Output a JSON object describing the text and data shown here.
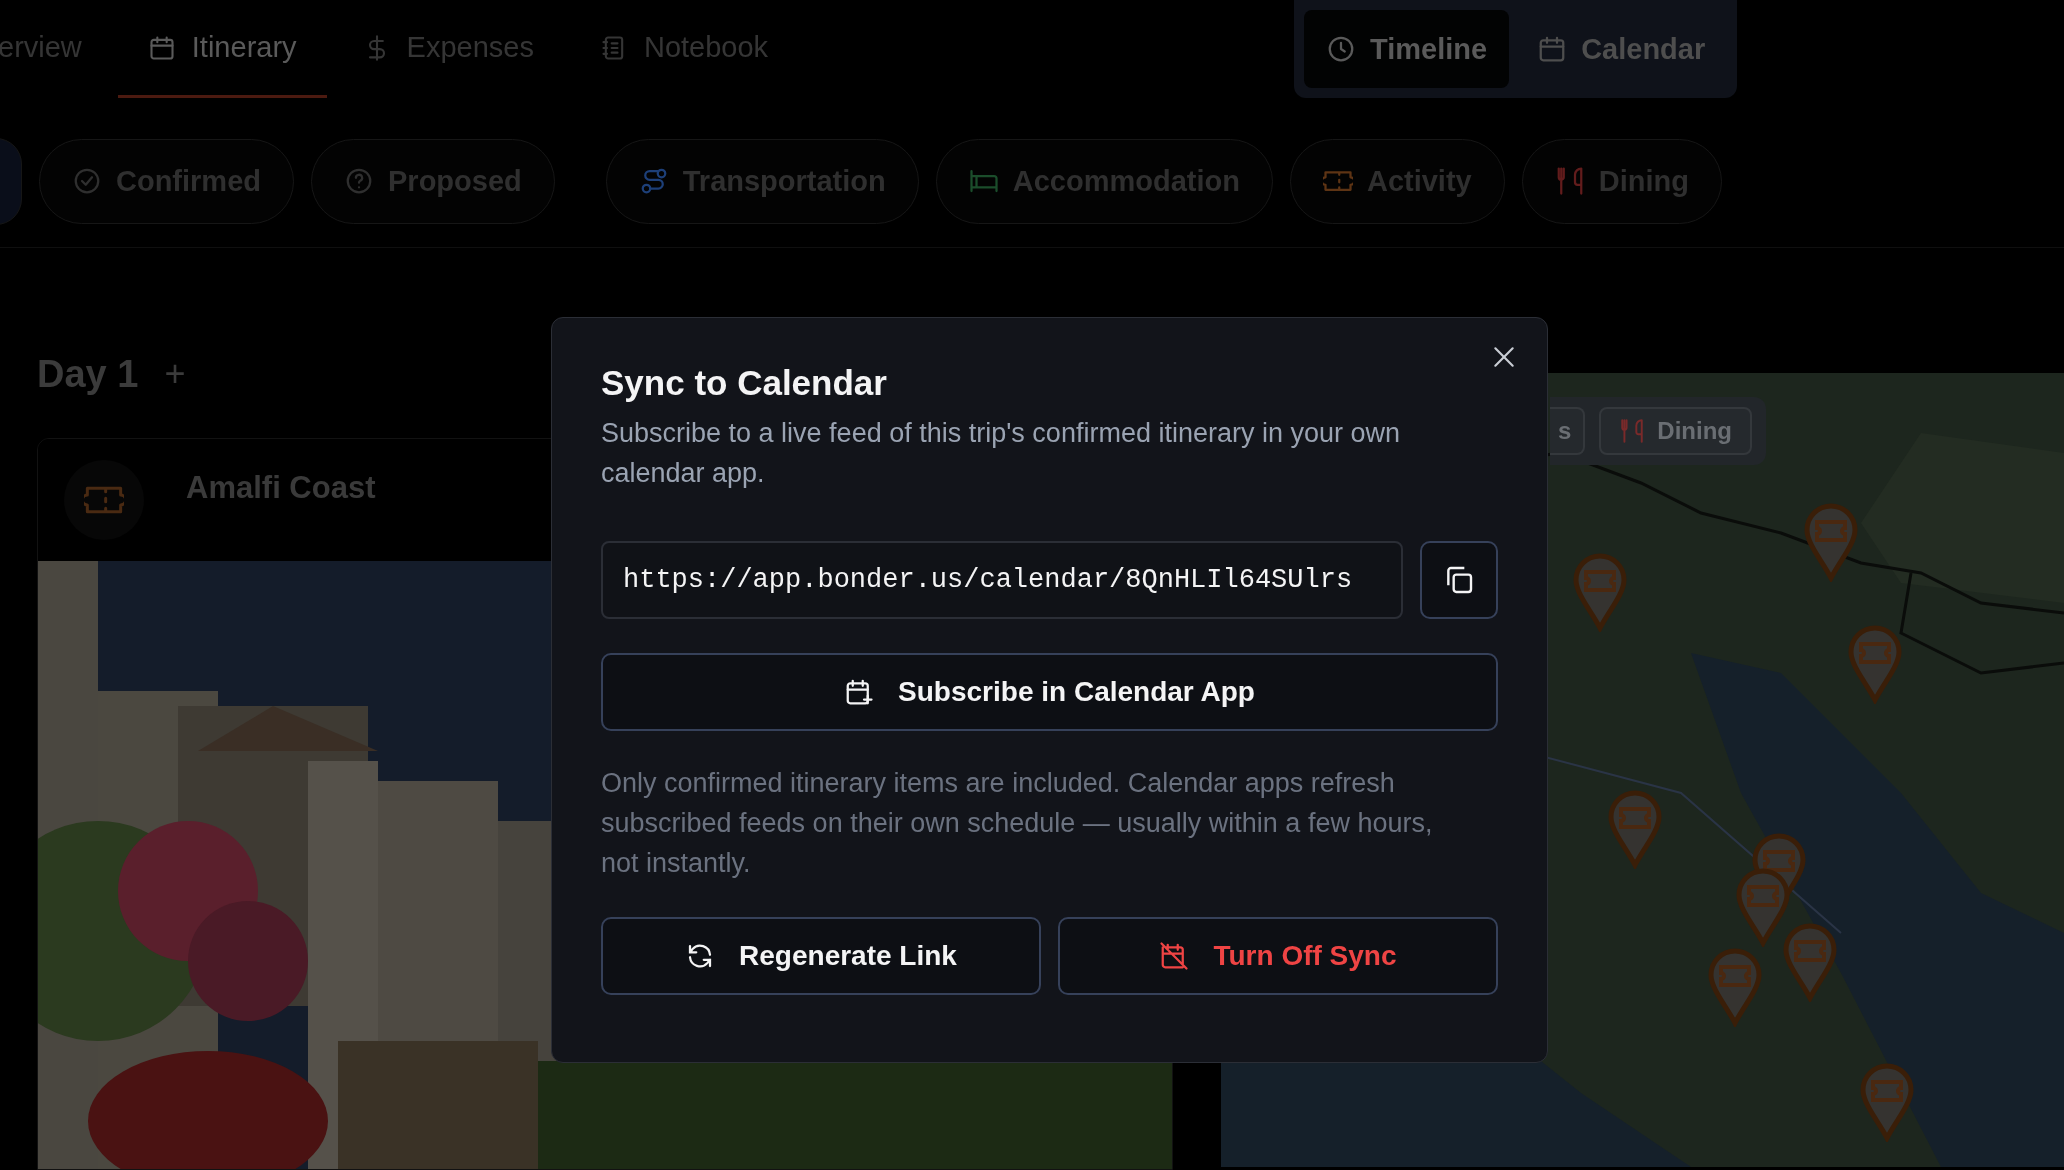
{
  "nav_tabs": [
    {
      "label": "erview",
      "kind": "overview",
      "selected": false
    },
    {
      "label": "Itinerary",
      "kind": "itinerary",
      "selected": true
    },
    {
      "label": "Expenses",
      "kind": "expenses",
      "selected": false
    },
    {
      "label": "Notebook",
      "kind": "notebook",
      "selected": false
    }
  ],
  "view_toggle": [
    {
      "label": "Timeline",
      "kind": "timeline",
      "selected": true
    },
    {
      "label": "Calendar",
      "kind": "calendar",
      "selected": false
    }
  ],
  "filters": [
    {
      "label": "Confirmed",
      "kind": "confirmed"
    },
    {
      "label": "Proposed",
      "kind": "proposed"
    },
    {
      "label": "Transportation",
      "kind": "transportation",
      "color": "#1d3f78"
    },
    {
      "label": "Accommodation",
      "kind": "accommodation",
      "color": "#1b4d2b"
    },
    {
      "label": "Activity",
      "kind": "activity",
      "color": "#5e3414"
    },
    {
      "label": "Dining",
      "kind": "dining",
      "color": "#621c1c"
    }
  ],
  "day": {
    "title": "Day 1",
    "add": "+"
  },
  "card": {
    "title": "Amalfi Coast"
  },
  "map": {
    "kind": "picture",
    "chips": [
      {
        "label": "s",
        "kind": "plain"
      },
      {
        "label": "Dining",
        "kind": "dining",
        "color": "#7a2a2a"
      }
    ]
  },
  "dialog": {
    "title": "Sync to Calendar",
    "description": "Subscribe to a live feed of this trip's confirmed itinerary in your own calendar app.",
    "url": "https://app.bonder.us/calendar/8QnHLIl64SUlrs",
    "subscribe": "Subscribe in Calendar App",
    "note": "Only confirmed itinerary items are included. Calendar apps refresh subscribed feeds on their own schedule — usually within a few hours, not instantly.",
    "actions": [
      {
        "label": "Regenerate Link",
        "kind": "regenerate"
      },
      {
        "label": "Turn Off Sync",
        "kind": "danger"
      }
    ]
  }
}
